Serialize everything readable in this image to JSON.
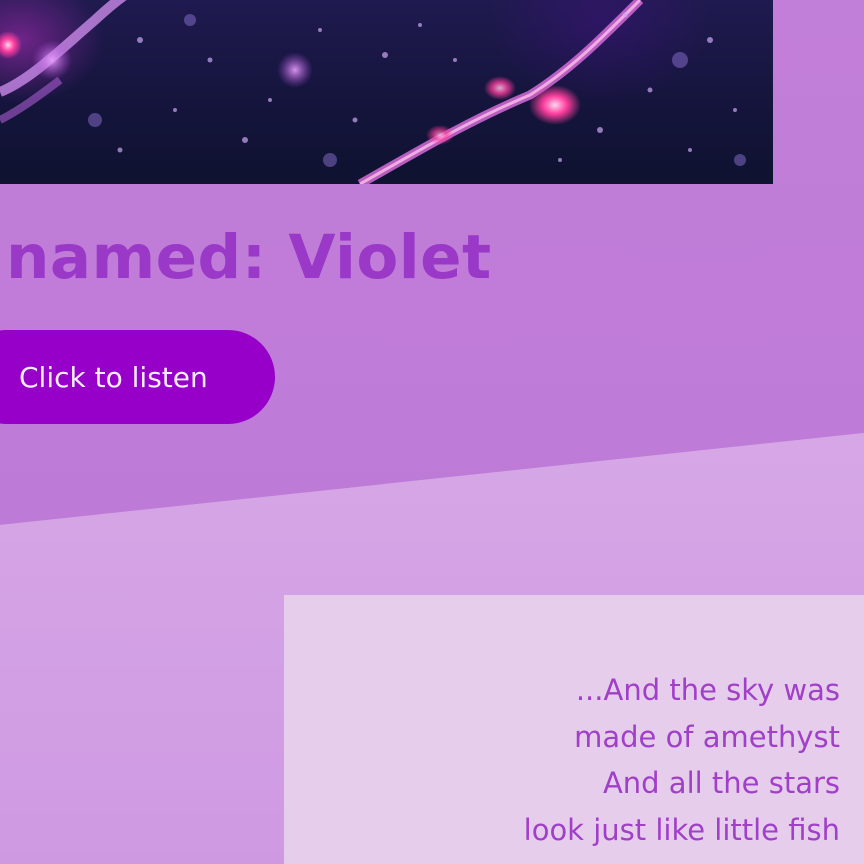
{
  "hero": {
    "image_alt": "purple underwater bokeh photo"
  },
  "headline": "named: Violet",
  "listen_button": "Click to listen",
  "lyrics": {
    "lines": [
      "...And the sky was",
      "made of amethyst",
      "And all the stars",
      "look just like little fish"
    ]
  },
  "colors": {
    "top_band": "#c27fd9",
    "lower_band": "#d6a7e6",
    "card": "#e7cdec",
    "headline": "#9a38c8",
    "button": "#9600c8",
    "lyrics_text": "#a03fc8"
  }
}
